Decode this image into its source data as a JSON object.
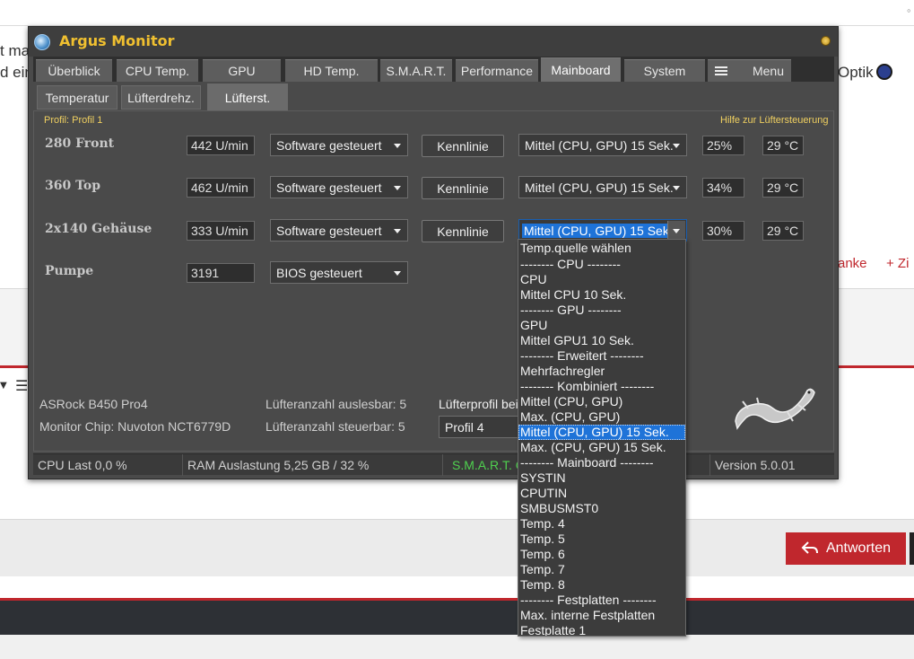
{
  "background": {
    "left_text_line1": "t ma",
    "left_text_line2": "d ein",
    "right_text": "Optik",
    "right_red_1": "anke",
    "right_red_2": "+ Zi",
    "corner_dot": "◦",
    "reply_button": "Antworten"
  },
  "window": {
    "title": "Argus Monitor",
    "tabs": [
      "Überblick",
      "CPU Temp.",
      "GPU",
      "HD Temp.",
      "S.M.A.R.T.",
      "Performance",
      "Mainboard",
      "System",
      "Menu"
    ],
    "active_tab": "Mainboard",
    "subtabs": [
      "Temperatur",
      "Lüfterdrehz.",
      "Lüfterst."
    ],
    "active_subtab": "Lüfterst.",
    "profile_label": "Profil: Profil 1",
    "help_link": "Hilfe zur Lüftersteuerung",
    "fans": [
      {
        "name": "280 Front",
        "rpm": "442 U/min",
        "mode": "Software gesteuert",
        "curve_button": "Kennlinie",
        "source": "Mittel (CPU, GPU) 15 Sek.",
        "percent": "25%",
        "temp": "29 °C"
      },
      {
        "name": "360 Top",
        "rpm": "462 U/min",
        "mode": "Software gesteuert",
        "curve_button": "Kennlinie",
        "source": "Mittel (CPU, GPU) 15 Sek.",
        "percent": "34%",
        "temp": "29 °C"
      },
      {
        "name": "2x140 Gehäuse",
        "rpm": "333 U/min",
        "mode": "Software gesteuert",
        "curve_button": "Kennlinie",
        "source": "Mittel (CPU, GPU) 15 Sek.",
        "percent": "30%",
        "temp": "29 °C"
      },
      {
        "name": "Pumpe",
        "rpm": "3191",
        "mode": "BIOS gesteuert"
      }
    ],
    "board": "ASRock B450 Pro4",
    "chip": "Monitor Chip: Nuvoton NCT6779D",
    "fans_readable": "Lüfteranzahl auslesbar: 5",
    "fans_controllable": "Lüfteranzahl steuerbar: 5",
    "fan_profile_label": "Lüfterprofil bei",
    "fan_profile_value": "Profil 4",
    "status": {
      "cpu_load": "CPU Last 0,0 %",
      "ram": "RAM Auslastung 5,25 GB / 32 %",
      "smart": "S.M.A.R.T. O",
      "version": "Version 5.0.01"
    }
  },
  "dropdown": {
    "items": [
      "Temp.quelle wählen",
      "-------- CPU --------",
      "CPU",
      "Mittel CPU 10 Sek.",
      "-------- GPU --------",
      "GPU",
      "Mittel GPU1 10 Sek.",
      "-------- Erweitert --------",
      "Mehrfachregler",
      "-------- Kombiniert --------",
      "Mittel (CPU, GPU)",
      "Max. (CPU, GPU)",
      "Mittel (CPU, GPU) 15 Sek.",
      "Max. (CPU, GPU) 15 Sek.",
      "-------- Mainboard --------",
      "SYSTIN",
      "CPUTIN",
      "SMBUSMST0",
      "Temp. 4",
      "Temp. 5",
      "Temp. 6",
      "Temp. 7",
      "Temp. 8",
      "-------- Festplatten --------",
      "Max. interne Festplatten",
      "Festplatte 1"
    ],
    "selected": "Mittel (CPU, GPU) 15 Sek."
  }
}
